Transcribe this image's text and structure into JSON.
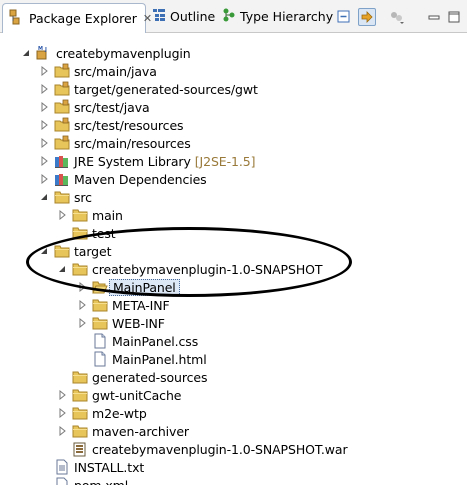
{
  "tabs": {
    "package_explorer": "Package Explorer",
    "outline": "Outline",
    "type_hierarchy": "Type Hierarchy",
    "close_glyph": "✕"
  },
  "tree": [
    {
      "label": "createbymavenplugin",
      "icon": "maven-project-icon",
      "expanded": true
    },
    {
      "label": "src/main/java",
      "icon": "source-folder-icon",
      "expanded": false
    },
    {
      "label": "target/generated-sources/gwt",
      "icon": "source-folder-icon",
      "expanded": false
    },
    {
      "label": "src/test/java",
      "icon": "source-folder-icon",
      "expanded": false
    },
    {
      "label": "src/test/resources",
      "icon": "source-folder-icon",
      "expanded": false
    },
    {
      "label": "src/main/resources",
      "icon": "source-folder-icon",
      "expanded": false
    },
    {
      "label": "JRE System Library",
      "suffix": "[J2SE-1.5]",
      "icon": "library-icon",
      "expanded": false
    },
    {
      "label": "Maven Dependencies",
      "icon": "library-icon",
      "expanded": false
    },
    {
      "label": "src",
      "icon": "folder-icon",
      "expanded": true
    },
    {
      "label": "main",
      "icon": "folder-icon",
      "expanded": false
    },
    {
      "label": "test",
      "icon": "folder-icon"
    },
    {
      "label": "target",
      "icon": "folder-icon",
      "expanded": true
    },
    {
      "label": "createbymavenplugin-1.0-SNAPSHOT",
      "icon": "folder-icon",
      "expanded": true
    },
    {
      "label": "MainPanel",
      "icon": "folder-open-icon",
      "expanded": false,
      "selected": true
    },
    {
      "label": "META-INF",
      "icon": "folder-icon",
      "expanded": false
    },
    {
      "label": "WEB-INF",
      "icon": "folder-icon",
      "expanded": false
    },
    {
      "label": "MainPanel.css",
      "icon": "file-icon"
    },
    {
      "label": "MainPanel.html",
      "icon": "file-icon"
    },
    {
      "label": "generated-sources",
      "icon": "folder-icon"
    },
    {
      "label": "gwt-unitCache",
      "icon": "folder-icon",
      "expanded": false
    },
    {
      "label": "m2e-wtp",
      "icon": "folder-icon",
      "expanded": false
    },
    {
      "label": "maven-archiver",
      "icon": "folder-icon",
      "expanded": false
    },
    {
      "label": "createbymavenplugin-1.0-SNAPSHOT.war",
      "icon": "war-file-icon"
    },
    {
      "label": "INSTALL.txt",
      "icon": "text-file-icon"
    },
    {
      "label": "pom.xml",
      "icon": "xml-file-icon"
    }
  ],
  "colors": {
    "folder": "#e8c55a",
    "selection": "#dde8f6",
    "accent": "#3d6fb4"
  }
}
